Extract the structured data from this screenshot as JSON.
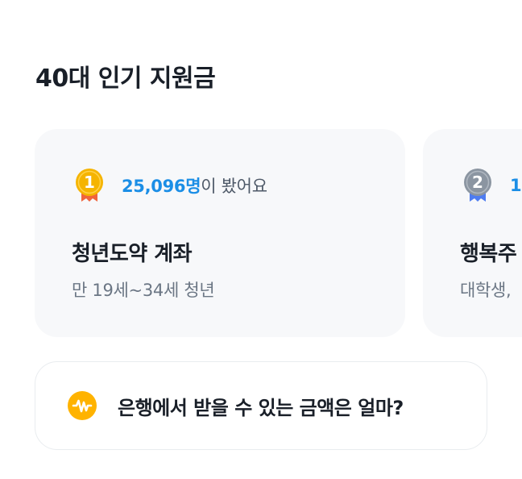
{
  "section": {
    "title": "40대 인기 지원금"
  },
  "cards": [
    {
      "rank": "1",
      "medal_color": "#f5b400",
      "ribbon_color": "#f0643c",
      "count": "25,096명",
      "count_suffix": "이 봤어요",
      "name": "청년도약 계좌",
      "desc": "만 19세~34세 청년"
    },
    {
      "rank": "2",
      "medal_color": "#8b95a1",
      "ribbon_color": "#4e7cf0",
      "count": "1",
      "count_suffix": "",
      "name": "행복주",
      "desc": "대학생,"
    }
  ],
  "banner": {
    "icon": "won-coin-icon",
    "icon_color": "#ffb300",
    "text": "은행에서 받을 수 있는 금액은 얼마?"
  },
  "colors": {
    "accent": "#1b8ee6",
    "card_bg": "#f7f8fa"
  }
}
